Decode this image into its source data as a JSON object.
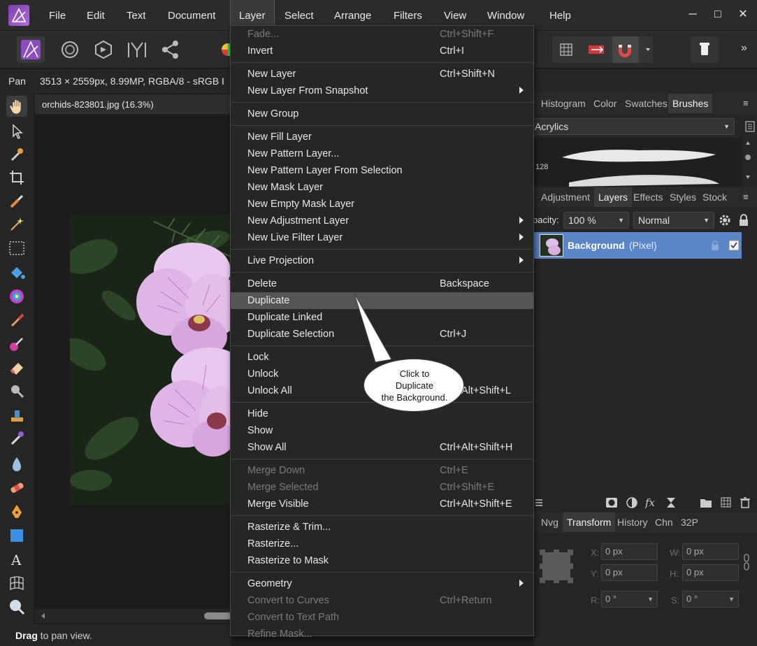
{
  "menubar": {
    "items": [
      "File",
      "Edit",
      "Text",
      "Document",
      "Layer",
      "Select",
      "Arrange",
      "Filters",
      "View",
      "Window",
      "Help"
    ],
    "active": "Layer",
    "window_controls": [
      "─",
      "□",
      "✕"
    ]
  },
  "toolbar": {
    "overflow": "»"
  },
  "context": {
    "tool": "Pan",
    "info": "3513 × 2559px, 8.99MP, RGBA/8 - sRGB I"
  },
  "document": {
    "tab": "orchids-823801.jpg (16.3%)"
  },
  "status": {
    "bold": "Drag",
    "rest": " to pan view."
  },
  "panels": {
    "top_tabs": [
      "Histogram",
      "Color",
      "Swatches",
      "Brushes"
    ],
    "top_active": "Brushes",
    "brush_category": "Acrylics",
    "brush_size": "128",
    "mid_tabs": [
      "Adjustment",
      "Layers",
      "Effects",
      "Styles",
      "Stock"
    ],
    "mid_active": "Layers",
    "opacity_label": "pacity:",
    "opacity_value": "100 %",
    "blend_mode": "Normal",
    "layer": {
      "name": "Background",
      "type": "(Pixel)"
    },
    "bottom_tabs": [
      "Nvg",
      "Transform",
      "History",
      "Chn",
      "32P"
    ],
    "bottom_active": "Transform",
    "transform": {
      "x_label": "X:",
      "x_value": "0 px",
      "y_label": "Y:",
      "y_value": "0 px",
      "w_label": "W:",
      "w_value": "0 px",
      "h_label": "H:",
      "h_value": "0 px",
      "r_label": "R:",
      "r_value": "0 °",
      "s_label": "S:",
      "s_value": "0 °"
    }
  },
  "layer_menu": {
    "items": [
      {
        "label": "Fade...",
        "shortcut": "Ctrl+Shift+F",
        "disabled": true
      },
      {
        "label": "Invert",
        "shortcut": "Ctrl+I"
      },
      {
        "sep": true
      },
      {
        "label": "New Layer",
        "shortcut": "Ctrl+Shift+N"
      },
      {
        "label": "New Layer From Snapshot",
        "submenu": true
      },
      {
        "sep": true
      },
      {
        "label": "New Group"
      },
      {
        "sep": true
      },
      {
        "label": "New Fill Layer"
      },
      {
        "label": "New Pattern Layer..."
      },
      {
        "label": "New Pattern Layer From Selection"
      },
      {
        "label": "New Mask Layer"
      },
      {
        "label": "New Empty Mask Layer"
      },
      {
        "label": "New Adjustment Layer",
        "submenu": true
      },
      {
        "label": "New Live Filter Layer",
        "submenu": true
      },
      {
        "sep": true
      },
      {
        "label": "Live Projection",
        "submenu": true
      },
      {
        "sep": true
      },
      {
        "label": "Delete",
        "shortcut": "Backspace"
      },
      {
        "label": "Duplicate",
        "highlighted": true
      },
      {
        "label": "Duplicate Linked"
      },
      {
        "label": "Duplicate Selection",
        "shortcut": "Ctrl+J"
      },
      {
        "sep": true
      },
      {
        "label": "Lock"
      },
      {
        "label": "Unlock"
      },
      {
        "label": "Unlock All",
        "shortcut": "Ctrl+Alt+Shift+L"
      },
      {
        "sep": true
      },
      {
        "label": "Hide"
      },
      {
        "label": "Show"
      },
      {
        "label": "Show All",
        "shortcut": "Ctrl+Alt+Shift+H"
      },
      {
        "sep": true
      },
      {
        "label": "Merge Down",
        "shortcut": "Ctrl+E",
        "disabled": true
      },
      {
        "label": "Merge Selected",
        "shortcut": "Ctrl+Shift+E",
        "disabled": true
      },
      {
        "label": "Merge Visible",
        "shortcut": "Ctrl+Alt+Shift+E"
      },
      {
        "sep": true
      },
      {
        "label": "Rasterize & Trim..."
      },
      {
        "label": "Rasterize..."
      },
      {
        "label": "Rasterize to Mask"
      },
      {
        "sep": true
      },
      {
        "label": "Geometry",
        "submenu": true
      },
      {
        "label": "Convert to Curves",
        "shortcut": "Ctrl+Return",
        "disabled": true
      },
      {
        "label": "Convert to Text Path",
        "disabled": true
      },
      {
        "label": "Refine Mask...",
        "disabled": true
      }
    ]
  },
  "callout": {
    "lines": [
      "Click to",
      "Duplicate",
      "the Background."
    ]
  },
  "colors": {
    "accent_selected_layer": "#5a86c7",
    "menu_highlight": "#555555",
    "app_logo": "#9b59d0"
  }
}
